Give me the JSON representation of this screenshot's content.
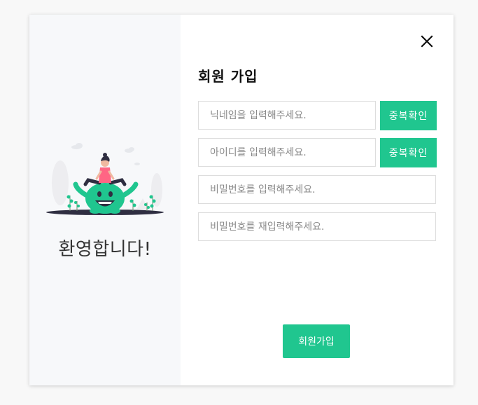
{
  "welcome": {
    "text": "환영합니다!"
  },
  "form": {
    "title": "회원 가입",
    "nickname": {
      "placeholder": "닉네임을 입력해주세요.",
      "value": ""
    },
    "user_id": {
      "placeholder": "아이디를 입력해주세요.",
      "value": ""
    },
    "password": {
      "placeholder": "비밀번호를 입력해주세요.",
      "value": ""
    },
    "password_confirm": {
      "placeholder": "비밀번호를 재입력해주세요.",
      "value": ""
    },
    "check_nickname_label": "중복확인",
    "check_id_label": "중복확인",
    "submit_label": "회원가입"
  },
  "icons": {
    "close": "close-icon",
    "illustration": "welcome-illustration"
  },
  "colors": {
    "accent": "#20c68f",
    "left_panel_bg": "#f7f8fa",
    "page_bg": "#f8f8f8"
  }
}
